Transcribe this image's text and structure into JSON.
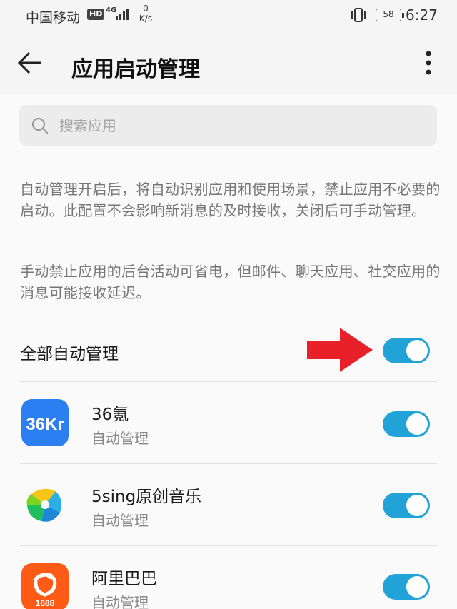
{
  "status_bar": {
    "carrier": "中国移动",
    "hd": "HD",
    "network": "4G",
    "speed_value": "0",
    "speed_unit": "K/s",
    "battery": "58",
    "time": "6:27"
  },
  "header": {
    "title": "应用启动管理"
  },
  "search": {
    "placeholder": "搜索应用"
  },
  "description": {
    "para1": "自动管理开启后，将自动识别应用和使用场景，禁止应用不必要的启动。此配置不会影响新消息的及时接收，关闭后可手动管理。",
    "para2": "手动禁止应用的后台活动可省电，但邮件、聊天应用、社交应用的消息可能接收延迟。"
  },
  "all_auto": {
    "label": "全部自动管理",
    "enabled": true
  },
  "apps": [
    {
      "name": "36氪",
      "status": "自动管理",
      "enabled": true,
      "icon": "36kr-icon",
      "icon_text": "36Kr"
    },
    {
      "name": "5sing原创音乐",
      "status": "自动管理",
      "enabled": true,
      "icon": "5sing-icon"
    },
    {
      "name": "阿里巴巴",
      "status": "自动管理",
      "enabled": true,
      "icon": "alibaba-1688-icon",
      "icon_text": "1688"
    }
  ],
  "colors": {
    "toggle_on": "#21a3d8",
    "arrow": "#e8202a"
  }
}
